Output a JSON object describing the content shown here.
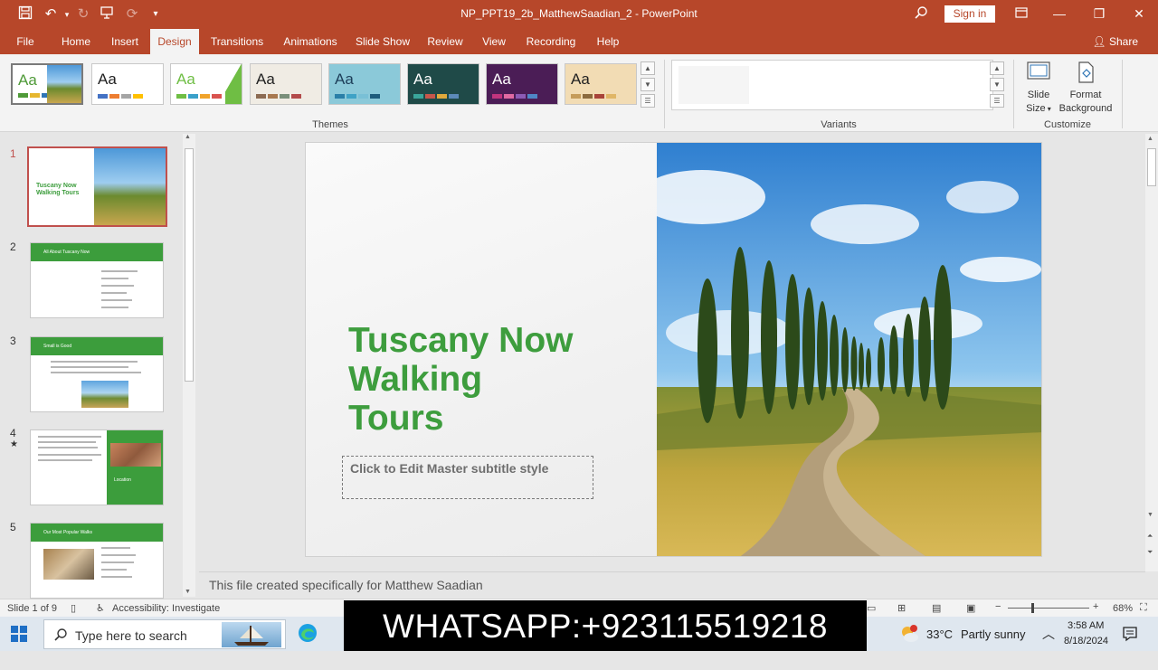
{
  "window": {
    "title": "NP_PPT19_2b_MatthewSaadian_2 - PowerPoint",
    "sign_in": "Sign in",
    "share": "Share"
  },
  "ribbon_tabs": [
    "File",
    "Home",
    "Insert",
    "Design",
    "Transitions",
    "Animations",
    "Slide Show",
    "Review",
    "View",
    "Recording",
    "Help"
  ],
  "active_tab": "Design",
  "themes": {
    "label": "Themes",
    "items": [
      {
        "label": "Aa",
        "bg": "#ffffff",
        "fg": "#4f9a38",
        "swatch": [
          "#4f9a38",
          "#e6b62e",
          "#2f75b5",
          "#c0504d"
        ]
      },
      {
        "label": "Aa",
        "bg": "#ffffff",
        "fg": "#222222",
        "swatch": [
          "#4472c4",
          "#ed7d31",
          "#a5a5a5",
          "#ffc000"
        ]
      },
      {
        "label": "Aa",
        "bg": "#ffffff",
        "fg": "#6fbe44",
        "swatch": [
          "#6fbe44",
          "#3aa0c9",
          "#f0a32b",
          "#d9534f"
        ]
      },
      {
        "label": "Aa",
        "bg": "#f0ece4",
        "fg": "#222222",
        "swatch": [
          "#8c6b52",
          "#a8784f",
          "#7a8f7a",
          "#b34b4b"
        ]
      },
      {
        "label": "Aa",
        "bg": "#8bc9d9",
        "fg": "#1d3e59",
        "swatch": [
          "#2a7fa8",
          "#3fa2c6",
          "#79c0d6",
          "#1e5c7c"
        ]
      },
      {
        "label": "Aa",
        "bg": "#1f4a48",
        "fg": "#ffffff",
        "swatch": [
          "#3aa59a",
          "#c7564b",
          "#e0a93c",
          "#5c8ab8"
        ]
      },
      {
        "label": "Aa",
        "bg": "#4b1d56",
        "fg": "#ffffff",
        "swatch": [
          "#c0347e",
          "#e06aa2",
          "#8c5bb5",
          "#4f86c6"
        ]
      },
      {
        "label": "Aa",
        "bg": "#f2dcb4",
        "fg": "#222222",
        "swatch": [
          "#c59b5a",
          "#8c6a3d",
          "#a9443a",
          "#e0b667"
        ]
      }
    ]
  },
  "variants": {
    "label": "Variants"
  },
  "customize": {
    "label": "Customize",
    "slide_size": [
      "Slide",
      "Size"
    ],
    "format_background": [
      "Format",
      "Background"
    ]
  },
  "slides_panel": {
    "items": [
      {
        "number": "1",
        "title": "Tuscany Now Walking Tours"
      },
      {
        "number": "2",
        "title": "All About Tuscany Now"
      },
      {
        "number": "3",
        "title": "Small is Good"
      },
      {
        "number": "4",
        "title": "Location",
        "starred": "★"
      },
      {
        "number": "5",
        "title": "Our Most Popular Walks"
      }
    ]
  },
  "slide": {
    "title_lines": [
      "Tuscany Now",
      "Walking",
      "Tours"
    ],
    "subtitle_placeholder": "Click to Edit Master subtitle style"
  },
  "notes_text": "This file created specifically for Matthew Saadian",
  "status_bar": {
    "slide_position": "Slide 1 of 9",
    "accessibility": "Accessibility: Investigate",
    "zoom": "68%"
  },
  "taskbar": {
    "search_placeholder": "Type here to search",
    "weather_temp": "33°C",
    "weather_desc": "Partly sunny",
    "time": "3:58 AM",
    "date": "8/18/2024"
  },
  "overlay_banner": "WHATSAPP:+923115519218"
}
